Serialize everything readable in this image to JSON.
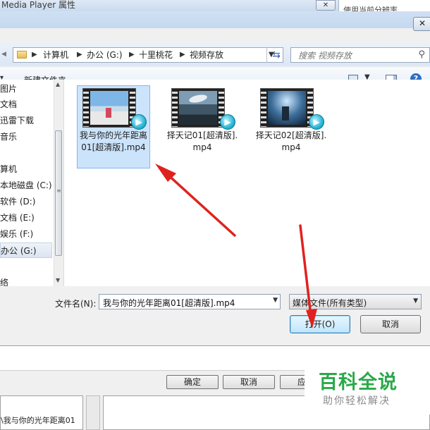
{
  "background_window": {
    "title": "Media Player 属性",
    "close_label": "✕",
    "right_text": "使用当前分辨率",
    "lower_buttons": [
      "确定",
      "取消",
      "应用"
    ],
    "lower_list_text": "\\我与你的光年距离01"
  },
  "dialog": {
    "close_label": "✕",
    "breadcrumb": [
      "计算机",
      "办公 (G:)",
      "十里桃花",
      "视频存放"
    ],
    "search_placeholder": "搜索 视频存放",
    "toolbar": {
      "new_folder": "新建文件夹"
    },
    "nav_items": [
      "图片",
      "文档",
      "迅雷下载",
      "音乐",
      "",
      "算机",
      "本地磁盘 (C:)",
      "软件 (D:)",
      "文档 (E:)",
      "娱乐 (F:)",
      "办公 (G:)",
      "",
      "络"
    ],
    "nav_selected_index": 10,
    "files": [
      {
        "name": "我与你的光年距离01[超清版].mp4",
        "selected": true
      },
      {
        "name": "择天记01[超清版].mp4",
        "selected": false
      },
      {
        "name": "择天记02[超清版].mp4",
        "selected": false
      }
    ],
    "filename_label": "文件名(N):",
    "filename_value": "我与你的光年距离01[超清版].mp4",
    "filetype_value": "媒体文件(所有类型)",
    "open_button": "打开(O)",
    "cancel_button": "取消"
  },
  "watermark": {
    "title": "百科全说",
    "subtitle": "助你轻松解决"
  },
  "colors": {
    "accent": "#2a6fc3",
    "selection": "#cce4fb",
    "annotation_arrow": "#e0221f",
    "watermark_green": "#2aa94a"
  }
}
